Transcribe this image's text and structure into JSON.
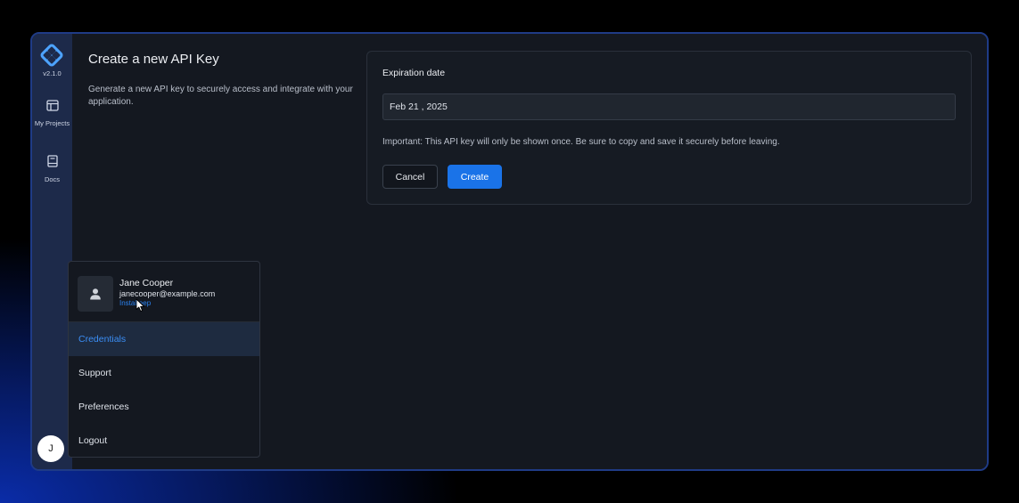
{
  "sidebar": {
    "version": "v2.1.0",
    "items": [
      {
        "label": "My Projects",
        "icon": "layout-icon"
      },
      {
        "label": "Docs",
        "icon": "book-icon"
      }
    ],
    "avatar_initial": "J"
  },
  "page": {
    "title": "Create a new API Key",
    "description": "Generate a new API key to securely access and integrate with your application."
  },
  "form": {
    "expiration_label": "Expiration date",
    "expiration_value": "Feb 21 , 2025",
    "important_note": "Important: This API key will only be shown once. Be sure to copy and save it securely before leaving.",
    "cancel_label": "Cancel",
    "create_label": "Create"
  },
  "user_menu": {
    "name": "Jane Cooper",
    "email": "janecooper@example.com",
    "link": "Instaheep",
    "items": [
      {
        "label": "Credentials",
        "active": true
      },
      {
        "label": "Support",
        "active": false
      },
      {
        "label": "Preferences",
        "active": false
      },
      {
        "label": "Logout",
        "active": false
      }
    ]
  },
  "colors": {
    "accent": "#1a73e8",
    "active_text": "#3b8ef5",
    "panel": "#141820",
    "sidebar": "#1d2a4a"
  }
}
